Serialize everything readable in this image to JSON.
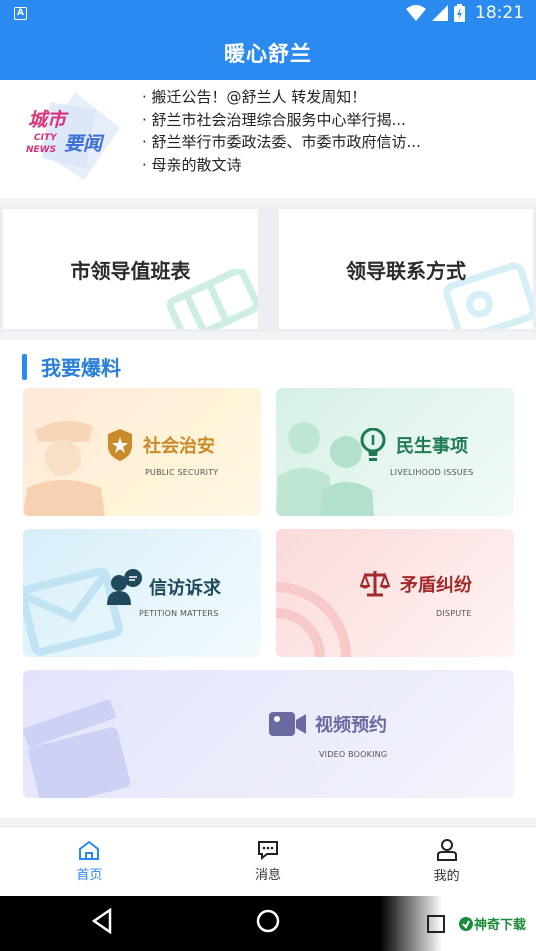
{
  "status_bar": {
    "time": "18:21",
    "notification_icon": "A"
  },
  "app_title": "暖心舒兰",
  "news": {
    "logo_cn_1": "城市",
    "logo_cn_2": "要闻",
    "logo_en_1": "CITY",
    "logo_en_2": "NEWS",
    "items": [
      "· 搬迁公告！@舒兰人 转发周知！",
      "· 舒兰市社会治理综合服务中心举行揭...",
      "· 舒兰举行市委政法委、市委市政府信访...",
      "· 母亲的散文诗"
    ]
  },
  "leaders": {
    "duty_schedule": "市领导值班表",
    "contact": "领导联系方式"
  },
  "report": {
    "title": "我要爆料",
    "tiles": {
      "security": {
        "name": "社会治安",
        "en": "PUBLIC SECURITY"
      },
      "livelihood": {
        "name": "民生事项",
        "en": "LIVELIHOOD ISSUES"
      },
      "petition": {
        "name": "信访诉求",
        "en": "PETITION MATTERS"
      },
      "dispute": {
        "name": "矛盾纠纷",
        "en": "DISPUTE"
      },
      "video": {
        "name": "视频预约",
        "en": "VIDEO BOOKING"
      }
    }
  },
  "tabbar": {
    "home": "首页",
    "messages": "消息",
    "mine": "我的"
  },
  "watermark": "神奇下载",
  "colors": {
    "primary": "#2a8af0",
    "security": "#c98a2a",
    "livelihood": "#1f7a55",
    "petition": "#1f4a5c",
    "dispute": "#a32a2a",
    "video": "#6a6aa0"
  }
}
